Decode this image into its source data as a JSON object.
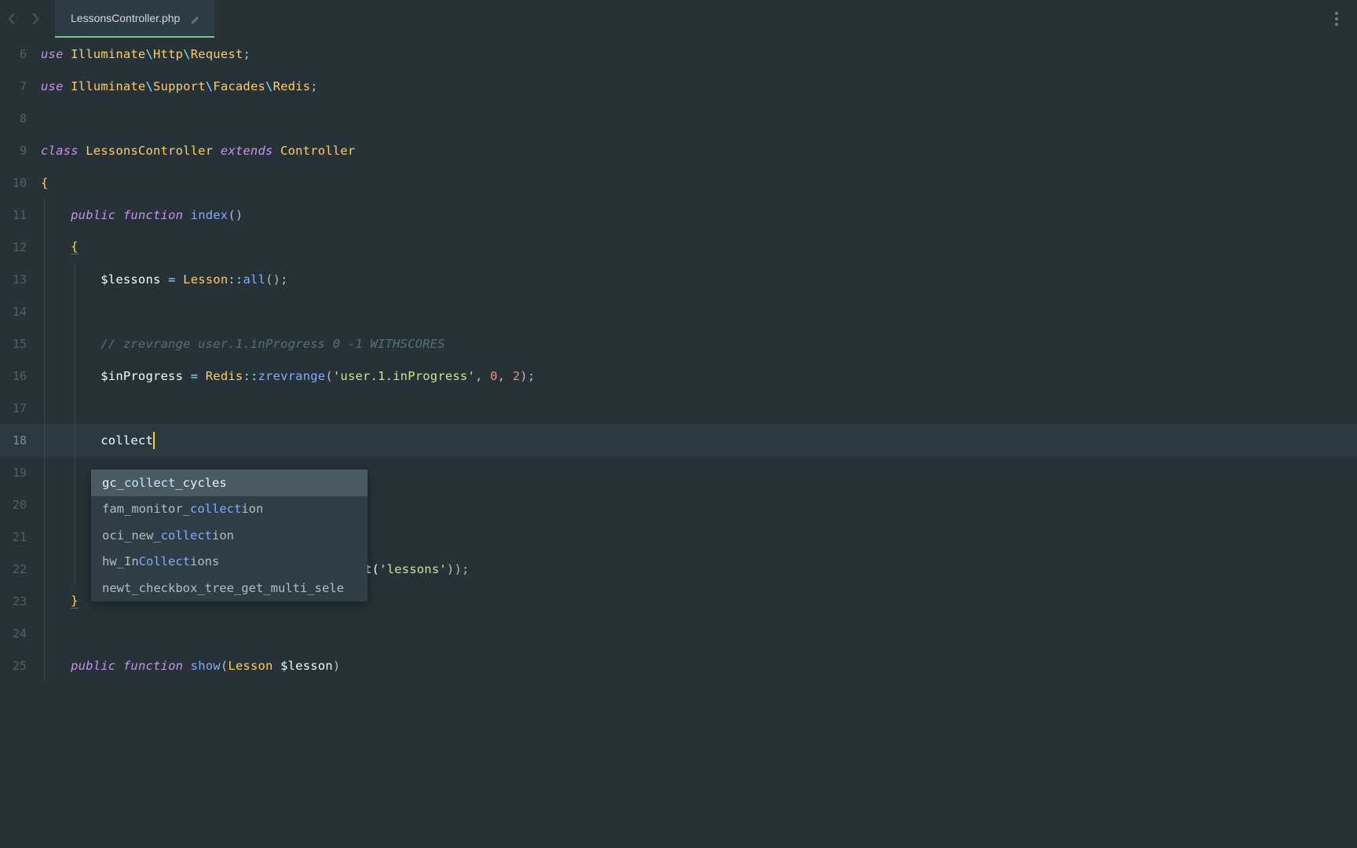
{
  "tab": {
    "filename": "LessonsController.php"
  },
  "gutter": {
    "start": 6,
    "numbers": [
      "6",
      "7",
      "8",
      "9",
      "10",
      "11",
      "12",
      "13",
      "14",
      "15",
      "16",
      "17",
      "18",
      "19",
      "20",
      "21",
      "22",
      "23",
      "24",
      "25"
    ]
  },
  "code": {
    "l6": {
      "use": "use ",
      "ns1": "Illuminate",
      "bs1": "\\",
      "ns2": "Http",
      "bs2": "\\",
      "ns3": "Request",
      "semi": ";"
    },
    "l7": {
      "use": "use ",
      "ns1": "Illuminate",
      "bs1": "\\",
      "ns2": "Support",
      "bs2": "\\",
      "ns3": "Facades",
      "bs3": "\\",
      "ns4": "Redis",
      "semi": ";"
    },
    "l9": {
      "class": "class ",
      "name": "LessonsController ",
      "extends": "extends ",
      "parent": "Controller"
    },
    "l10": {
      "brace": "{"
    },
    "l11": {
      "indent": "    ",
      "public": "public ",
      "function": "function ",
      "name": "index",
      "paren": "()"
    },
    "l12": {
      "indent": "    ",
      "brace": "{"
    },
    "l13": {
      "indent": "        ",
      "var": "$lessons",
      "sp1": " ",
      "eq": "=",
      "sp2": " ",
      "cls": "Lesson",
      "dcolon": "::",
      "method": "all",
      "paren": "()",
      "semi": ";"
    },
    "l15": {
      "indent": "        ",
      "comment": "// zrevrange user.1.inProgress 0 -1 WITHSCORES"
    },
    "l16": {
      "indent": "        ",
      "var": "$inProgress",
      "sp1": " ",
      "eq": "=",
      "sp2": " ",
      "cls": "Redis",
      "dcolon": "::",
      "method": "zrevrange",
      "op": "(",
      "q1": "'",
      "str": "user.1.inProgress",
      "q2": "'",
      "comma1": ",",
      "sp3": " ",
      "n1": "0",
      "comma2": ",",
      "sp4": " ",
      "n2": "2",
      "cp": ")",
      "semi": ";"
    },
    "l18": {
      "indent": "        ",
      "text": "collect"
    },
    "l22_tail": {
      "txt1": "t(",
      "q1": "'",
      "str": "lessons",
      "q2": "'",
      "cp": "))",
      "semi": ";"
    },
    "l23": {
      "indent": "    ",
      "brace": "}"
    },
    "l25": {
      "indent": "    ",
      "public": "public ",
      "function": "function ",
      "name": "show",
      "op": "(",
      "type": "Lesson ",
      "var": "$lesson",
      "cp": ")"
    }
  },
  "autocomplete": {
    "items": [
      {
        "pre": "gc_",
        "match": "collect",
        "post": "_cycles"
      },
      {
        "pre": "fam_monitor_",
        "match": "collect",
        "post": "ion"
      },
      {
        "pre": "oci_new_",
        "match": "collect",
        "post": "ion"
      },
      {
        "pre": "hw_In",
        "match": "Collect",
        "post": "ions"
      },
      {
        "pre": "newt_checkbox_tree_get_multi_sele",
        "match": "",
        "post": ""
      }
    ],
    "selected_index": 0
  }
}
